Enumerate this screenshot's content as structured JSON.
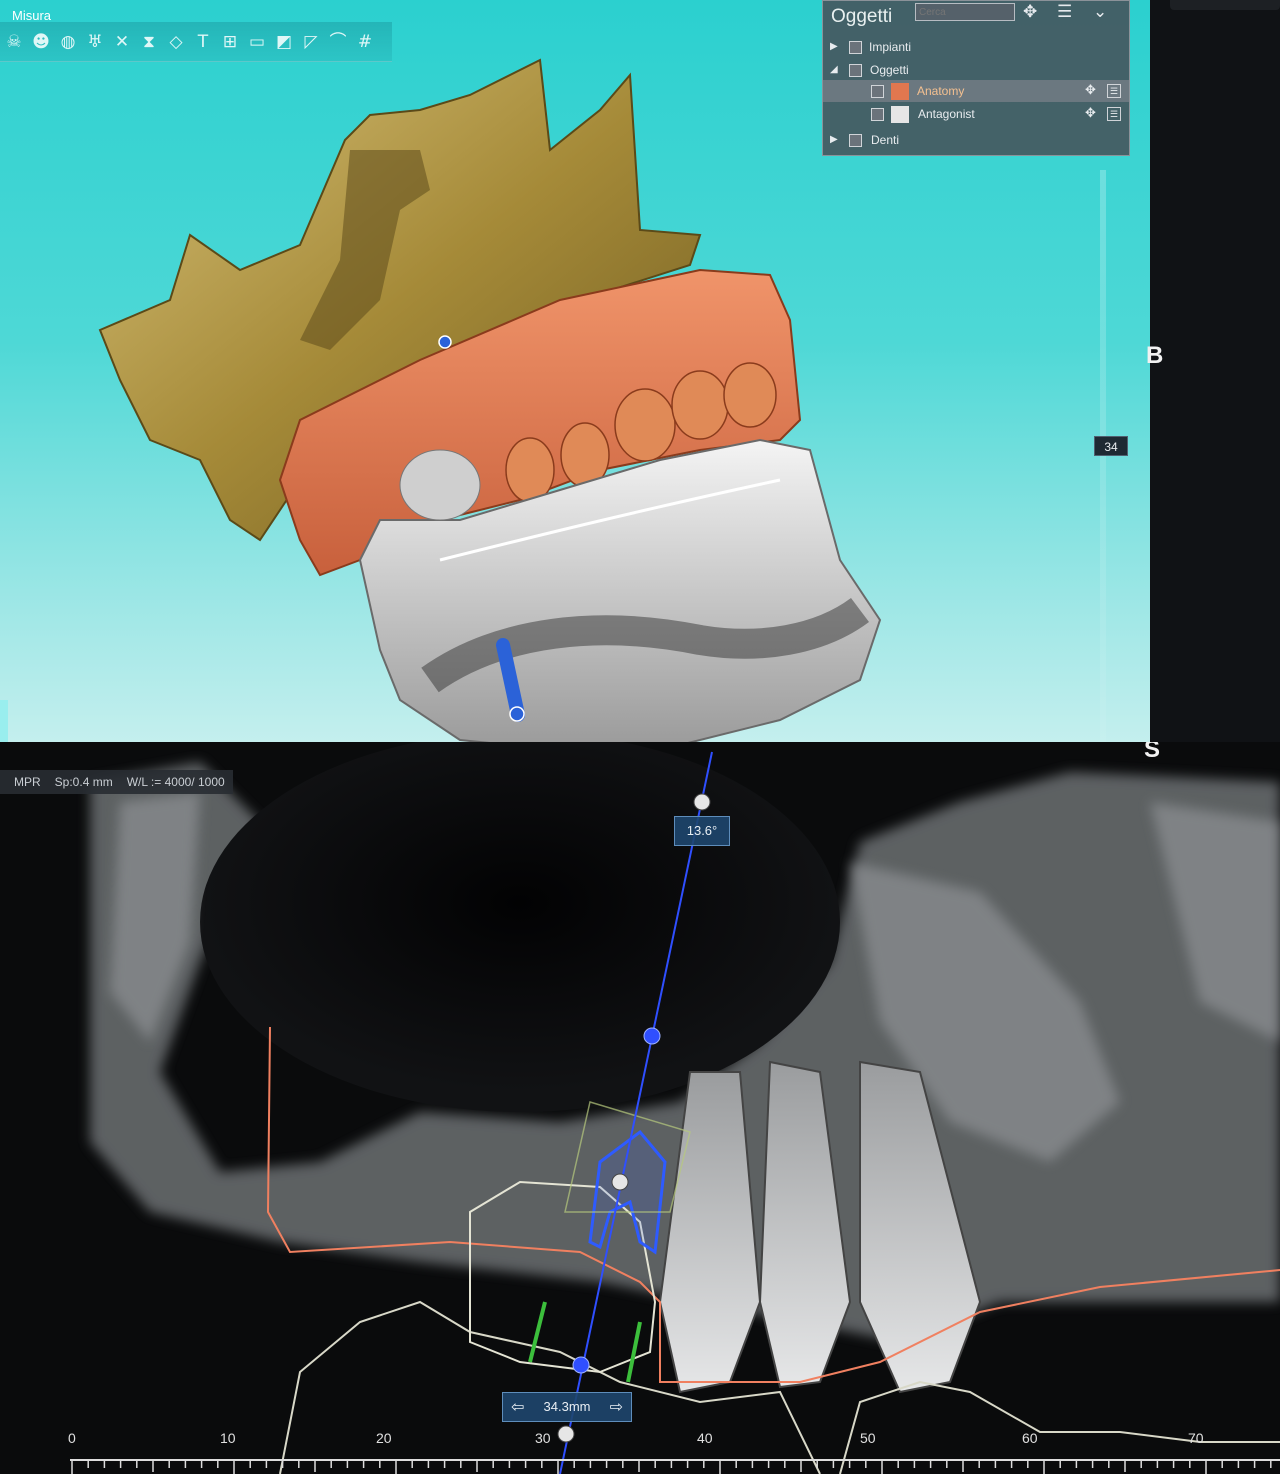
{
  "app": {
    "toolbar_title": "Misura",
    "toolbar_icons": [
      "skull-icon",
      "head-icon",
      "globe-icon",
      "tooth-icon",
      "close-icon",
      "implant-icon",
      "eraser-icon",
      "text-icon",
      "ruler-icon",
      "panorama-icon",
      "plane-icon",
      "cut-icon",
      "curve-icon",
      "grid-icon"
    ]
  },
  "objects_panel": {
    "title": "Oggetti",
    "search_placeholder": "Cerca",
    "groups": [
      {
        "label": "Impianti",
        "expanded": false
      },
      {
        "label": "Oggetti",
        "expanded": true,
        "children": [
          {
            "label": "Anatomy",
            "color": "#e2774f"
          },
          {
            "label": "Antagonist",
            "color": "#e6e6e6"
          }
        ]
      },
      {
        "label": "Denti",
        "expanded": false
      }
    ]
  },
  "slider": {
    "value": "34"
  },
  "orientation": {
    "right": "B",
    "bottom": "S"
  },
  "mpr": {
    "mode": "MPR",
    "spacing": "Sp:0.4 mm",
    "window_level": "W/L := 4000/ 1000",
    "angle": "13.6°",
    "length": "34.3mm",
    "ruler_ticks": [
      "0",
      "10",
      "20",
      "30",
      "40",
      "50",
      "60",
      "70"
    ]
  },
  "colors": {
    "anatomy": "#e2774f",
    "bone": "#b09a4a",
    "implant_axis": "#2f4fff",
    "nerve_curve": "#f08060",
    "background_3d": "#2bd0cf"
  }
}
